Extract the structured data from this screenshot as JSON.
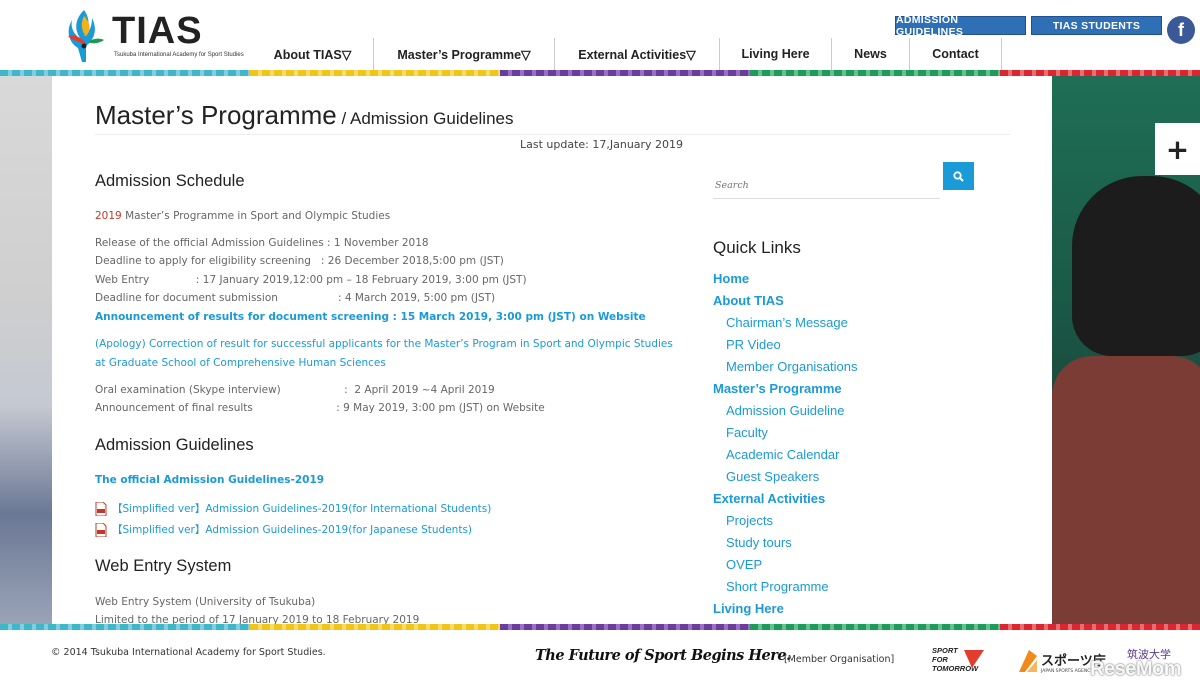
{
  "header": {
    "logo_text": "TIAS",
    "logo_sub": "Tsukuba International Academy for Sport Studies",
    "nav": [
      {
        "label": "About TIAS▽"
      },
      {
        "label": "Master’s Programme▽"
      },
      {
        "label": "External Activities▽"
      },
      {
        "label": "Living Here"
      },
      {
        "label": "News"
      },
      {
        "label": "Contact"
      }
    ],
    "top_buttons": {
      "admission": "ADMISSION GUIDELINES",
      "students": "TIAS STUDENTS"
    },
    "facebook_icon": "f"
  },
  "page": {
    "title_main": "Master’s Programme",
    "title_sub": " / Admission Guidelines",
    "last_update": "Last update: 17,January 2019"
  },
  "schedule": {
    "heading": "Admission Schedule",
    "year": "2019",
    "programme": " Master’s Programme in Sport and Olympic Studies",
    "lines": [
      "Release of the official Admission Guidelines : 1 November 2018",
      "Deadline to apply for eligibility screening   : 26 December 2018,5:00 pm (JST)",
      "Web Entry              : 17 January 2019,12:00 pm – 18 February 2019, 3:00 pm (JST)",
      "Deadline for document submission                  : 4 March 2019, 5:00 pm (JST)"
    ],
    "announcement": "Announcement of results for document screening : 15 March 2019, 3:00 pm (JST) on Website",
    "apology": "(Apology) Correction of result for successful applicants for the Master’s Program in Sport and Olympic Studies at Graduate School of Comprehensive Human Sciences",
    "oral_exam": "Oral examination (Skype interview)                   :  2 April 2019 ~4 April 2019",
    "final_results": "Announcement of final results                         : 9 May 2019, 3:00 pm (JST) on Website"
  },
  "guidelines": {
    "heading": "Admission Guidelines",
    "official": "The official Admission Guidelines-2019",
    "simplified_intl": "【Simplified ver】Admission Guidelines-2019(for International Students)",
    "simplified_jp": "【Simplified ver】Admission Guidelines-2019(for Japanese Students)"
  },
  "web_entry": {
    "heading": "Web Entry System",
    "line1": "Web Entry System (University of Tsukuba)",
    "line2": "Limited to the period of 17 January 2019 to 18 February 2019"
  },
  "sidebar": {
    "search_placeholder": "Search",
    "quick_links_title": "Quick Links",
    "links": [
      {
        "label": "Home",
        "level": "top"
      },
      {
        "label": "About TIAS",
        "level": "top"
      },
      {
        "label": "Chairman’s Message",
        "level": "sub"
      },
      {
        "label": "PR Video",
        "level": "sub"
      },
      {
        "label": "Member Organisations",
        "level": "sub"
      },
      {
        "label": "Master’s Programme",
        "level": "top"
      },
      {
        "label": "Admission Guideline",
        "level": "sub"
      },
      {
        "label": "Faculty",
        "level": "sub"
      },
      {
        "label": "Academic Calendar",
        "level": "sub"
      },
      {
        "label": "Guest Speakers",
        "level": "sub"
      },
      {
        "label": "External Activities",
        "level": "top"
      },
      {
        "label": "Projects",
        "level": "sub"
      },
      {
        "label": "Study tours",
        "level": "sub"
      },
      {
        "label": "OVEP",
        "level": "sub"
      },
      {
        "label": "Short Programme",
        "level": "sub"
      },
      {
        "label": "Living Here",
        "level": "top"
      }
    ]
  },
  "footer": {
    "copyright": "© 2014 Tsukuba International Academy for Sport Studies.",
    "tagline": "The Future of Sport Begins Here.",
    "member_org": "[Member Organisation]",
    "sft_line1": "SPORT",
    "sft_line2": "FOR",
    "sft_line3": "TOMORROW",
    "jsa_name": "スポーツ庁",
    "jsa_sub": "JAPAN SPORTS AGENCY",
    "tsukuba_name": "筑波大学",
    "watermark": "ReseMom"
  },
  "colors": {
    "accent_blue": "#1a9ad6",
    "header_button": "#2f6fb6",
    "year_red": "#c0392b",
    "facebook": "#3b5998"
  }
}
